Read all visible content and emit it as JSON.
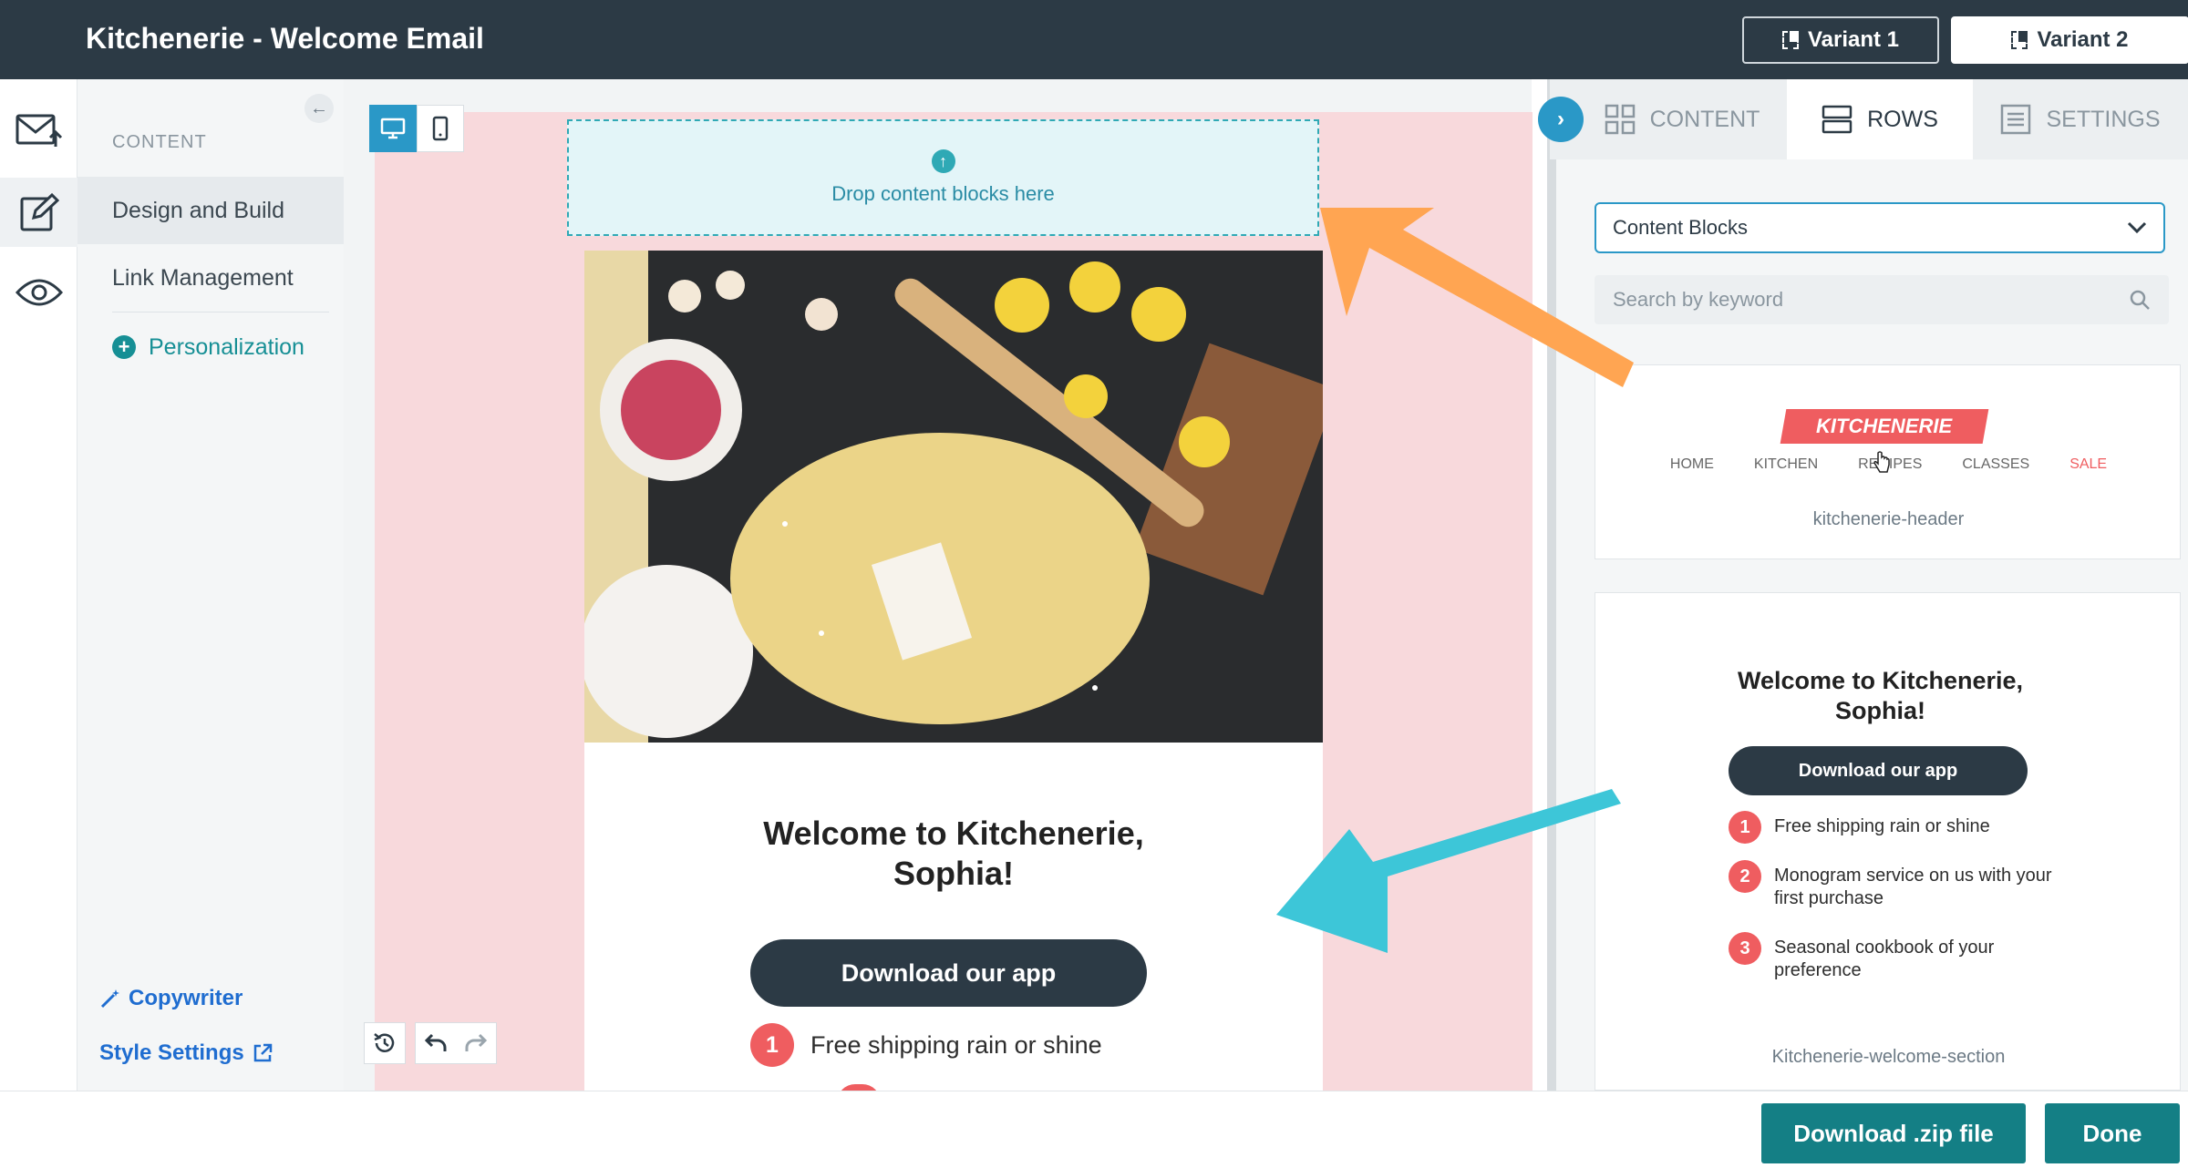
{
  "header": {
    "title": "Kitchenerie - Welcome Email",
    "variant1_label": "Variant 1",
    "variant2_label": "Variant 2"
  },
  "sidenav": {
    "heading": "CONTENT",
    "items": [
      {
        "label": "Design and Build"
      },
      {
        "label": "Link Management"
      },
      {
        "label": "Personalization"
      }
    ],
    "copywriter_label": "Copywriter",
    "style_settings_label": "Style Settings"
  },
  "canvas": {
    "dropzone_text": "Drop content blocks here",
    "welcome_title_line1": "Welcome to Kitchenerie,",
    "welcome_title_line2": "Sophia!",
    "app_button_label": "Download our app",
    "feature1_num": "1",
    "feature1_text": "Free shipping rain or shine"
  },
  "panel": {
    "tabs": [
      {
        "label": "CONTENT"
      },
      {
        "label": "ROWS"
      },
      {
        "label": "SETTINGS"
      }
    ],
    "select_value": "Content Blocks",
    "search_placeholder": "Search by keyword",
    "header_card": {
      "logo_text": "KITCHENERIE",
      "nav": [
        "HOME",
        "KITCHEN",
        "RECIPES",
        "CLASSES",
        "SALE"
      ],
      "label": "kitchenerie-header"
    },
    "welcome_card": {
      "title_line1": "Welcome to Kitchenerie,",
      "title_line2": "Sophia!",
      "button_label": "Download our app",
      "features": [
        {
          "num": "1",
          "text": "Free shipping rain or shine"
        },
        {
          "num": "2",
          "text": "Monogram service on us with your first purchase"
        },
        {
          "num": "3",
          "text": "Seasonal cookbook of your preference"
        }
      ],
      "label": "Kitchenerie-welcome-section"
    }
  },
  "footer": {
    "download_zip_label": "Download .zip file",
    "done_label": "Done"
  },
  "colors": {
    "topbar": "#2c3a45",
    "accent_teal": "#147f85",
    "accent_blue": "#2a98c7",
    "brand_red": "#ef5d60",
    "email_bg_pink": "#f8d9dc",
    "arrow_orange": "#ffa552",
    "arrow_cyan": "#3dc6d8"
  }
}
